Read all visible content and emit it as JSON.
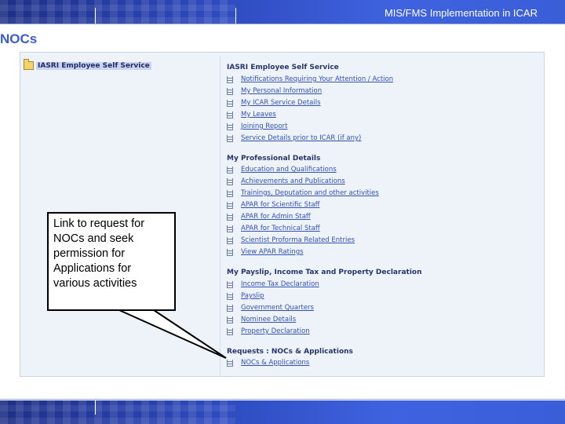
{
  "header": {
    "title": "MIS/FMS Implementation in ICAR"
  },
  "page": {
    "title": "NOCs"
  },
  "tree": {
    "root_label": "IASRI Employee Self Service"
  },
  "menu": {
    "sections": [
      {
        "heading": "IASRI Employee Self Service",
        "items": [
          "Notifications Requiring Your Attention / Action",
          "My Personal Information",
          "My ICAR Service Details",
          "My Leaves",
          "Joining Report",
          "Service Details prior to ICAR (if any)"
        ]
      },
      {
        "heading": "My Professional Details",
        "items": [
          "Education and Qualifications",
          "Achievements and Publications",
          "Trainings, Deputation and other activities",
          "APAR for Scientific Staff",
          "APAR for Admin Staff",
          "APAR for Technical Staff",
          "Scientist Proforma Related Entries",
          "View APAR Ratings"
        ]
      },
      {
        "heading": "My Payslip, Income Tax and Property Declaration",
        "items": [
          "Income Tax Declaration",
          "Payslip",
          "Government Quarters",
          "Nominee Details",
          "Property Declaration"
        ]
      },
      {
        "heading": "Requests : NOCs & Applications",
        "items": [
          "NOCs & Applications"
        ]
      }
    ]
  },
  "callout": {
    "text": "Link to request for NOCs and seek permission for Applications for various activities"
  },
  "colors": {
    "banner": "#2f4cc0",
    "title": "#3b5bd6",
    "link": "#3150b8",
    "heading": "#26356d"
  }
}
